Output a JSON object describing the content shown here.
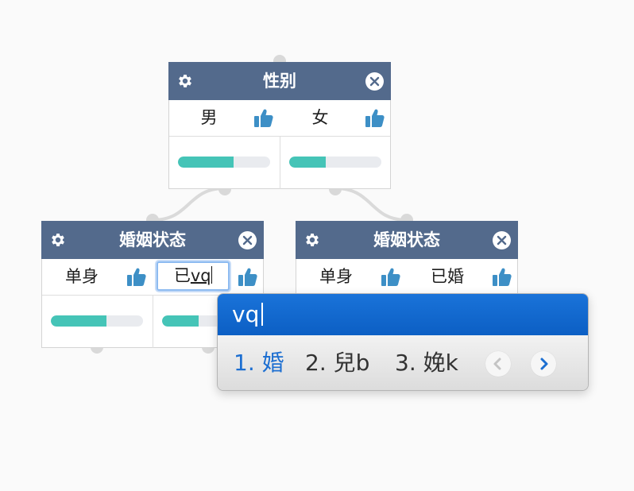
{
  "nodes": {
    "gender": {
      "title": "性别",
      "options": [
        {
          "label": "男",
          "progress": 0.6
        },
        {
          "label": "女",
          "progress": 0.4
        }
      ]
    },
    "marital_left": {
      "title": "婚姻状态",
      "options": [
        {
          "label": "单身",
          "progress": 0.6
        },
        {
          "label_prefix": "已",
          "composing": "vq",
          "progress": 0.4
        }
      ]
    },
    "marital_right": {
      "title": "婚姻状态",
      "options": [
        {
          "label": "单身"
        },
        {
          "label": "已婚"
        }
      ]
    }
  },
  "ime": {
    "composition": "vq",
    "candidates": [
      "1. 婚",
      "2. 兒b",
      "3. 娩k"
    ],
    "selected_index": 0
  },
  "colors": {
    "header": "#536a8c",
    "progress_fill": "#45c4b7",
    "like_icon": "#3d8fc6",
    "ime_blue": "#1a73d9",
    "ime_selected": "#1d6fd1"
  },
  "icons": [
    "gear-icon",
    "close-icon",
    "thumbs-up-icon",
    "chevron-left-icon",
    "chevron-right-icon"
  ]
}
